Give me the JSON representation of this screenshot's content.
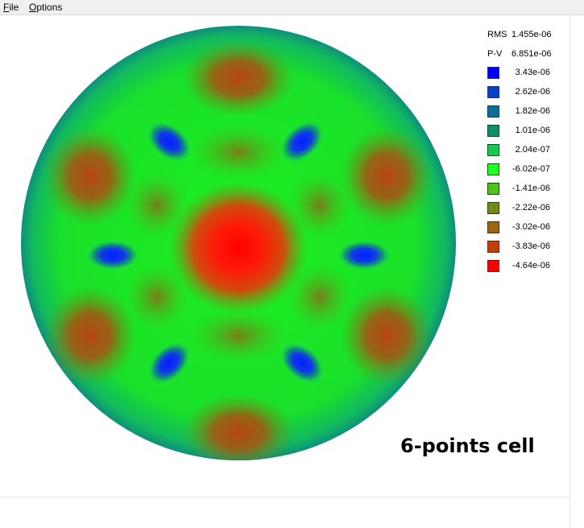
{
  "menu": {
    "items": [
      {
        "label": "File",
        "accel": "F",
        "rest": "ile"
      },
      {
        "label": "Options",
        "accel": "O",
        "rest": "ptions"
      }
    ]
  },
  "stats": {
    "rms_label": "RMS",
    "rms_value": "1.455e-06",
    "pv_label": "P-V",
    "pv_value": "6.851e-06"
  },
  "legend": [
    {
      "value": "3.43e-06",
      "color": "#0000ff"
    },
    {
      "value": "2.62e-06",
      "color": "#0a3fcc"
    },
    {
      "value": "1.82e-06",
      "color": "#0b6e9a"
    },
    {
      "value": "1.01e-06",
      "color": "#0f8f6a"
    },
    {
      "value": "2.04e-07",
      "color": "#18c850"
    },
    {
      "value": "-6.02e-07",
      "color": "#22ff22"
    },
    {
      "value": "-1.41e-06",
      "color": "#4ec21a"
    },
    {
      "value": "-2.22e-06",
      "color": "#6e8a14"
    },
    {
      "value": "-3.02e-06",
      "color": "#9c6414"
    },
    {
      "value": "-3.83e-06",
      "color": "#c0400c"
    },
    {
      "value": "-4.64e-06",
      "color": "#ff0000"
    }
  ],
  "caption": "6-points cell",
  "colors": {
    "background": "#ffffff",
    "menubar": "#f0f0f0",
    "base_green": "#19e02a",
    "edge_teal": "#0f9a7a",
    "peak_red": "#ff1010",
    "ring_brown": "#a04a14",
    "dimple_blue": "#1030e0"
  }
}
